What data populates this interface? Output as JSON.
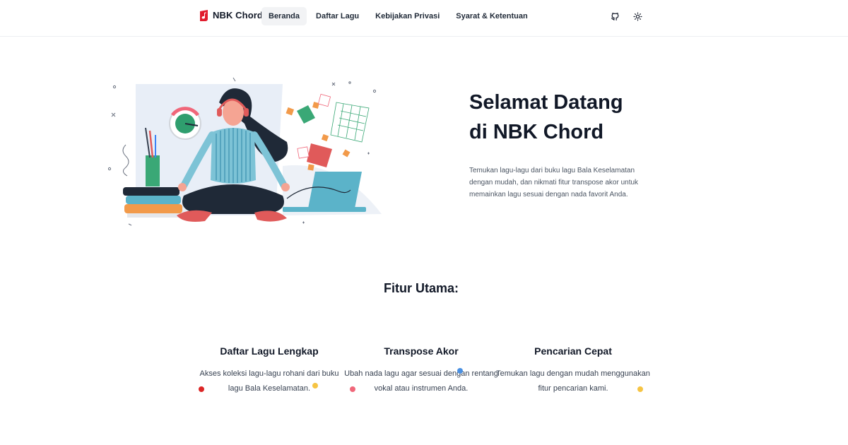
{
  "header": {
    "brand_name": "NBK Chord",
    "nav": [
      {
        "label": "Beranda",
        "active": true
      },
      {
        "label": "Daftar Lagu",
        "active": false
      },
      {
        "label": "Kebijakan Privasi",
        "active": false
      },
      {
        "label": "Syarat & Ketentuan",
        "active": false
      }
    ],
    "icons": [
      "github-icon",
      "sun-icon"
    ]
  },
  "hero": {
    "title_line1": "Selamat Datang",
    "title_line2_prefix": "di ",
    "title_highlight": "NBK",
    "title_line2_suffix": " Chord",
    "description": "Temukan lagu-lagu dari buku lagu Bala Keselamatan dengan mudah, dan nikmati fitur transpose akor untuk memainkan lagu sesuai dengan nada favorit Anda."
  },
  "features": {
    "title": "Fitur Utama:",
    "items": [
      {
        "title": "Daftar Lagu Lengkap",
        "description": "Akses koleksi lagu-lagu rohani dari buku lagu Bala Keselamatan."
      },
      {
        "title": "Transpose Akor",
        "description": "Ubah nada lagu agar sesuai dengan rentang vokal atau instrumen Anda."
      },
      {
        "title": "Pencarian Cepat",
        "description": "Temukan lagu dengan mudah menggunakan fitur pencarian kami."
      }
    ]
  },
  "colors": {
    "brand_red": "#e11d2e",
    "highlight": "#f6b6ba",
    "dot_red": "#dc2626",
    "dot_yellow": "#f6c443",
    "dot_blue": "#4a90e2",
    "dot_pink": "#f0677a"
  }
}
